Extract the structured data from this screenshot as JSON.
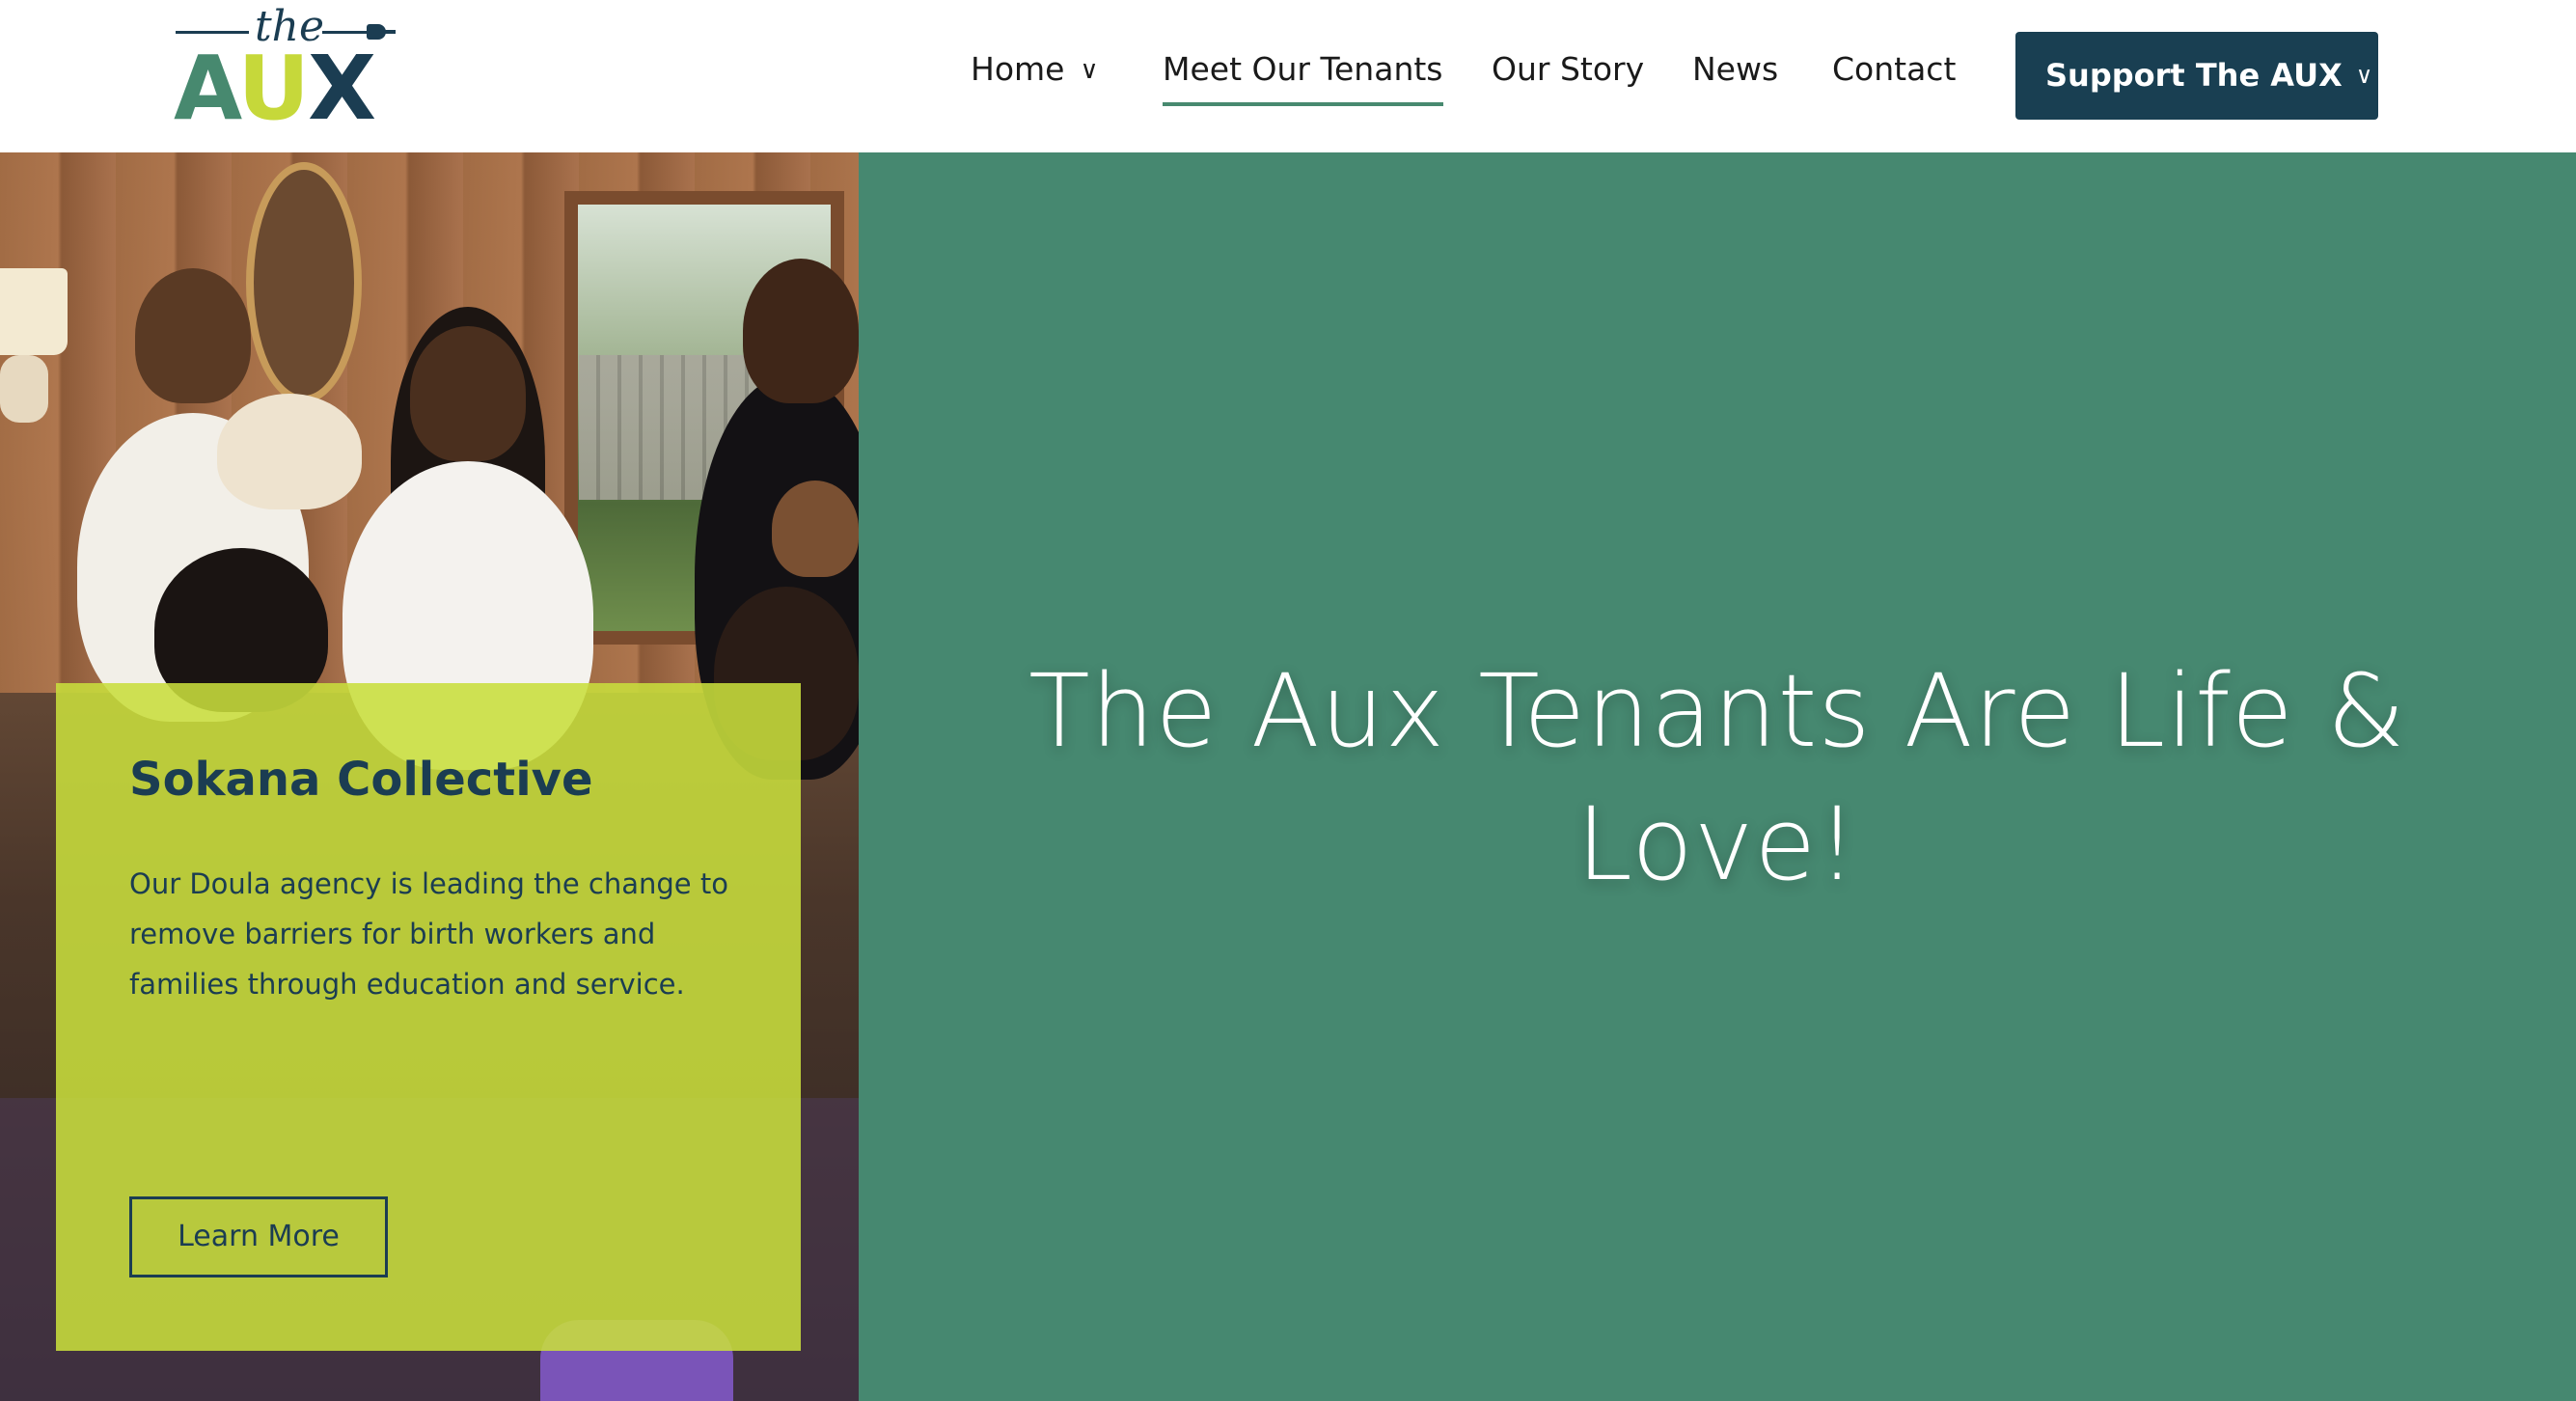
{
  "logo": {
    "the": "the",
    "aux_a": "A",
    "aux_u": "U",
    "aux_x": "X"
  },
  "nav": {
    "home": "Home",
    "tenants": "Meet Our Tenants",
    "story": "Our Story",
    "news": "News",
    "contact": "Contact",
    "active": "Meet Our Tenants"
  },
  "support_button": "Support The AUX",
  "card": {
    "title": "Sokana Collective",
    "text": "Our Doula agency is leading the change to remove barriers for birth workers and families through education and service.",
    "button": "Learn More"
  },
  "hero": {
    "headline": "The Aux Tenants Are Life & Love!"
  },
  "colors": {
    "green_panel": "#468870",
    "navy": "#193f52",
    "lime": "#c8de3c",
    "active_underline": "#47896f"
  },
  "icons": {
    "nav_dropdown": "chevron-down-icon",
    "support_dropdown": "chevron-down-icon"
  }
}
